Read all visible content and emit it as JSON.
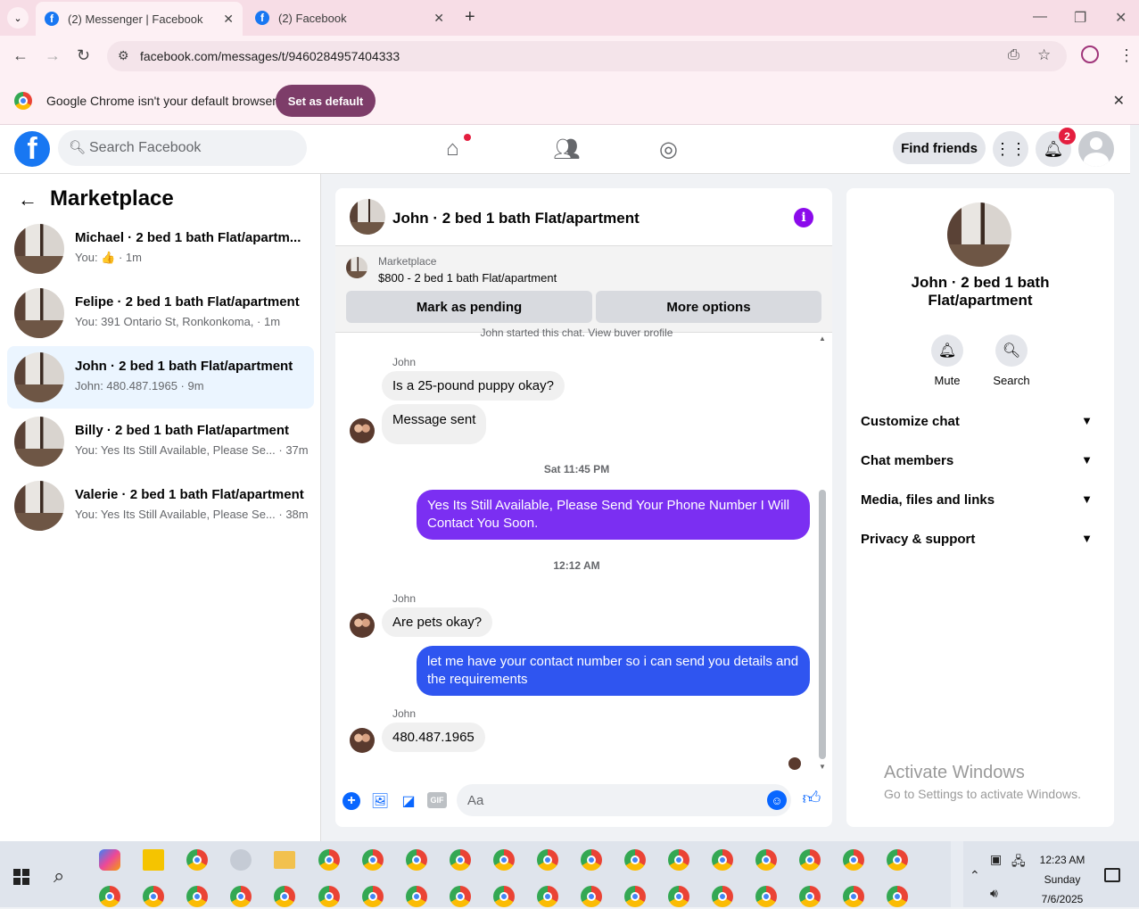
{
  "browser": {
    "tabs": [
      {
        "title": "(2) Messenger | Facebook",
        "active": true
      },
      {
        "title": "(2) Facebook",
        "active": false
      }
    ],
    "url": "facebook.com/messages/t/9460284957404333",
    "infobar": {
      "message": "Google Chrome isn't your default browser",
      "button": "Set as default"
    }
  },
  "fb": {
    "search_placeholder": "Search Facebook",
    "find_friends": "Find friends",
    "notification_count": "2"
  },
  "sidebar": {
    "title": "Marketplace",
    "conversations": [
      {
        "name": "Michael · 2 bed 1 bath Flat/apartm...",
        "preview": "You: 👍 · 1m",
        "selected": false
      },
      {
        "name": "Felipe · 2 bed 1 bath Flat/apartment",
        "preview": "You: 391 Ontario St, Ronkonkoma, · 1m",
        "selected": false
      },
      {
        "name": "John · 2 bed 1 bath Flat/apartment",
        "preview": "John: 480.487.1965 · 9m",
        "selected": true
      },
      {
        "name": "Billy · 2 bed 1 bath Flat/apartment",
        "preview": "You: Yes Its Still Available, Please Se... · 37m",
        "selected": false
      },
      {
        "name": "Valerie · 2 bed 1 bath Flat/apartment",
        "preview": "You: Yes Its Still Available, Please Se... · 38m",
        "selected": false
      }
    ]
  },
  "chat": {
    "header_name": "John · 2 bed 1 bath Flat/apartment",
    "marketplace_label": "Marketplace",
    "listing": "$800 - 2 bed 1 bath Flat/apartment",
    "mark_pending": "Mark as pending",
    "more_options": "More options",
    "partial_top": "John started this chat. View buyer profile",
    "sender": "John",
    "msg1": "Is a 25-pound puppy okay?",
    "msg2": "Message sent",
    "time1": "Sat 11:45 PM",
    "out1": "Yes Its Still Available, Please Send Your Phone Number I Will Contact You Soon.",
    "time2": "12:12 AM",
    "msg3": "Are pets okay?",
    "out2": "let me have your contact number so i can send you details and the requirements",
    "msg4": "480.487.1965",
    "composer_placeholder": "Aa",
    "colors": {
      "purple": "#7b2ff2",
      "blue": "#2f55f0"
    }
  },
  "right": {
    "name": "John · 2 bed 1 bath Flat/apartment",
    "mute": "Mute",
    "search": "Search",
    "sections": [
      "Customize chat",
      "Chat members",
      "Media, files and links",
      "Privacy & support"
    ],
    "activate_title": "Activate Windows",
    "activate_sub": "Go to Settings to activate Windows."
  },
  "taskbar": {
    "time": "12:23 AM",
    "day": "Sunday",
    "date": "7/6/2025"
  }
}
